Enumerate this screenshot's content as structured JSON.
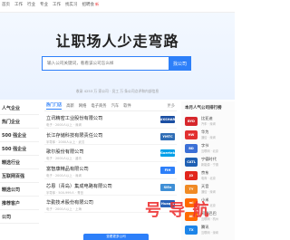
{
  "nav": {
    "items": [
      "首页",
      "工作",
      "行业",
      "专业",
      "工作",
      "找实习",
      "招聘会"
    ],
    "new_badge": "新"
  },
  "hero": {
    "title": "让职场人少走弯路",
    "search_placeholder": "输入公司关键词，看看该公司怎么样",
    "search_button": "找公司",
    "subtitle": "收录 4253 万 家公司 · 员工 万 条公司点评和内部信息"
  },
  "sidebar": {
    "items": [
      "人气企业",
      "热门企业",
      "500 强企业",
      "500 强企业",
      "精选行业",
      "互联网百强",
      "精选公司",
      "推荐客户",
      "公司"
    ]
  },
  "main": {
    "tabs": [
      "热门门店",
      "高新",
      "网络",
      "电子商务",
      "汽车",
      "软件",
      "更多"
    ],
    "companies": [
      {
        "name": "立讯精密工业股份有限公司",
        "meta": "电子 · 2000人以上 · 深圳",
        "logo": "LUXSHARE",
        "logo_color": "#1b4fa3"
      },
      {
        "name": "长江存储科技有限责任公司",
        "meta": "半导体 · 2000人以上 · 武汉",
        "logo": "YMTC",
        "logo_color": "#2f6db5"
      },
      {
        "name": "歌尔股份有限公司",
        "meta": "电子 · 2000人以上 · 潍坊",
        "logo": "Goertek",
        "logo_color": "#00a0e9"
      },
      {
        "name": "富智康精品有限公司",
        "meta": "电子 · 2000人以上 · 深圳",
        "logo": "FIH",
        "logo_color": "#2d7ff9"
      },
      {
        "name": "芯恩（青岛）集成电路有限公司",
        "meta": "半导体 · 500-999人 · 青岛",
        "logo": "SiEn",
        "logo_color": "#3f8fd6"
      },
      {
        "name": "华勤技术股份有限公司",
        "meta": "电子 · 2000人以上 · 上海",
        "logo": "Huaqin",
        "logo_color": "#2a62b8"
      }
    ]
  },
  "right": {
    "title": "本月人气公司排行榜",
    "ranks": [
      {
        "name": "比亚迪",
        "tag": "汽车 · 深圳",
        "logo": "BYD",
        "logo_color": "#d6262b"
      },
      {
        "name": "华为",
        "tag": "通信 · 深圳",
        "logo": "HW",
        "logo_color": "#e23030"
      },
      {
        "name": "字节",
        "tag": "互联网 · 北京",
        "logo": "BD",
        "logo_color": "#3b6fd6"
      },
      {
        "name": "宁德时代",
        "tag": "新能源 · 宁德",
        "logo": "CATL",
        "logo_color": "#1e5fb3"
      },
      {
        "name": "京东",
        "tag": "电商 · 北京",
        "logo": "JD",
        "logo_color": "#e1251b"
      },
      {
        "name": "天音",
        "tag": "通信 · 深圳",
        "logo": "TY",
        "logo_color": "#f08a24"
      },
      {
        "name": "小米",
        "tag": "电子 · 北京",
        "logo": "mi",
        "logo_color": "#ff6900"
      },
      {
        "name": "阿里巴巴",
        "tag": "互联网 · 杭州",
        "logo": "Ali",
        "logo_color": "#ff6a00"
      },
      {
        "name": "腾讯",
        "tag": "互联网 · 深圳",
        "logo": "TX",
        "logo_color": "#1c84e8"
      }
    ]
  },
  "float_bar": "查看更多公司",
  "watermark": "号 导 航"
}
